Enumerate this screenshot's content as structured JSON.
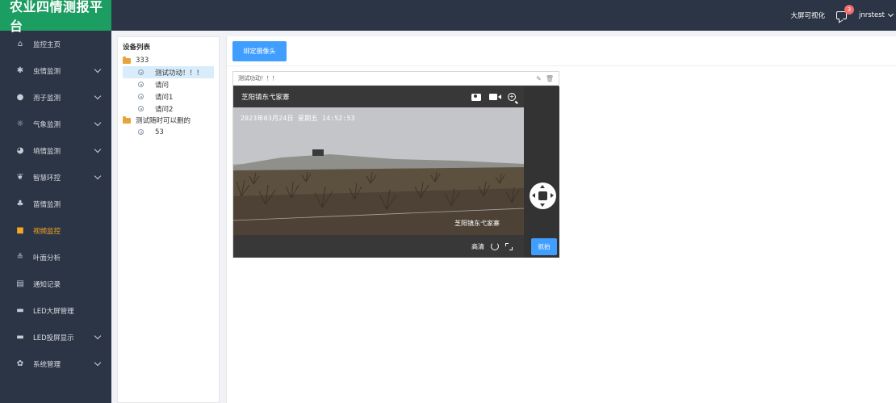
{
  "app": {
    "title": "农业四情测报平台"
  },
  "header": {
    "bigscreen_label": "大屏可视化",
    "message_badge": "3",
    "username": "jnrstest"
  },
  "sidebar": {
    "items": [
      {
        "label": "监控主页",
        "icon": "home-icon",
        "has_children": false
      },
      {
        "label": "虫情监测",
        "icon": "bug-icon",
        "has_children": true
      },
      {
        "label": "孢子监测",
        "icon": "spore-icon",
        "has_children": true
      },
      {
        "label": "气象监测",
        "icon": "weather-icon",
        "has_children": true
      },
      {
        "label": "墒情监测",
        "icon": "soil-icon",
        "has_children": true
      },
      {
        "label": "智慧环控",
        "icon": "leaf-icon",
        "has_children": true
      },
      {
        "label": "苗情监测",
        "icon": "seedling-icon",
        "has_children": false
      },
      {
        "label": "视频监控",
        "icon": "video-icon",
        "has_children": false,
        "active": true
      },
      {
        "label": "叶面分析",
        "icon": "leaf-analysis-icon",
        "has_children": false
      },
      {
        "label": "通知记录",
        "icon": "notice-icon",
        "has_children": false
      },
      {
        "label": "LED大屏管理",
        "icon": "monitor-icon",
        "has_children": false
      },
      {
        "label": "LED投屏显示",
        "icon": "monitor-icon",
        "has_children": true
      },
      {
        "label": "系统管理",
        "icon": "gear-icon",
        "has_children": true
      }
    ]
  },
  "device_panel": {
    "title": "设备列表",
    "groups": [
      {
        "name": "333",
        "devices": [
          "测试功动！！！",
          "请问",
          "请问1",
          "请问2"
        ]
      },
      {
        "name": "测试随时可以删的",
        "devices": [
          "53"
        ]
      }
    ]
  },
  "main": {
    "bind_button_label": "绑定摄像头",
    "camera": {
      "card_title": "测试功动！！！",
      "video_title": "芝阳镇东弋家寨",
      "osd_timestamp": "2023年03月24日 星期五 14:52:53",
      "osd_location": "芝阳镇东弋家寨",
      "quality_label": "高清",
      "capture_label": "抓拍"
    }
  }
}
